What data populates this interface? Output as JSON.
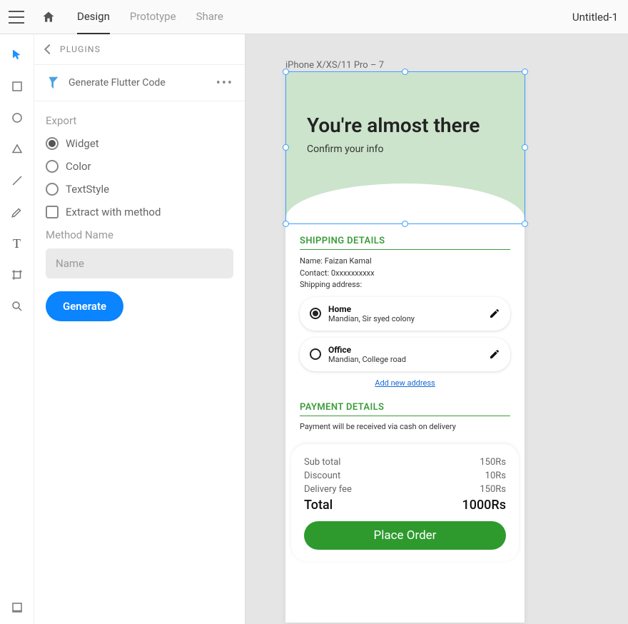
{
  "topbar": {
    "tabs": {
      "design": "Design",
      "prototype": "Prototype",
      "share": "Share"
    },
    "doc_title": "Untitled-1"
  },
  "panel": {
    "header": "PLUGINS",
    "plugin_name": "Generate Flutter Code",
    "export_title": "Export",
    "options": {
      "widget": "Widget",
      "color": "Color",
      "textstyle": "TextStyle",
      "extract": "Extract with method"
    },
    "method_label": "Method Name",
    "method_placeholder": "Name",
    "generate_label": "Generate"
  },
  "artboard": {
    "label": "iPhone X/XS/11 Pro – 7",
    "hero_title": "You're almost there",
    "hero_sub": "Confirm your info",
    "shipping": {
      "header": "SHIPPING DETAILS",
      "name_line": "Name: Faizan Kamal",
      "contact_line": "Contact: 0xxxxxxxxxx",
      "addr_line": "Shipping address:",
      "addresses": [
        {
          "title": "Home",
          "sub": "Mandian, Sir syed colony",
          "selected": true
        },
        {
          "title": "Office",
          "sub": "Mandian, College road",
          "selected": false
        }
      ],
      "add_link": "Add new address"
    },
    "payment": {
      "header": "PAYMENT DETAILS",
      "note": "Payment will be received via cash on delivery"
    },
    "summary": {
      "rows": [
        {
          "label": "Sub total",
          "value": "150Rs"
        },
        {
          "label": "Discount",
          "value": "10Rs"
        },
        {
          "label": "Delivery fee",
          "value": "150Rs"
        }
      ],
      "total_label": "Total",
      "total_value": "1000Rs",
      "button": "Place Order"
    }
  }
}
